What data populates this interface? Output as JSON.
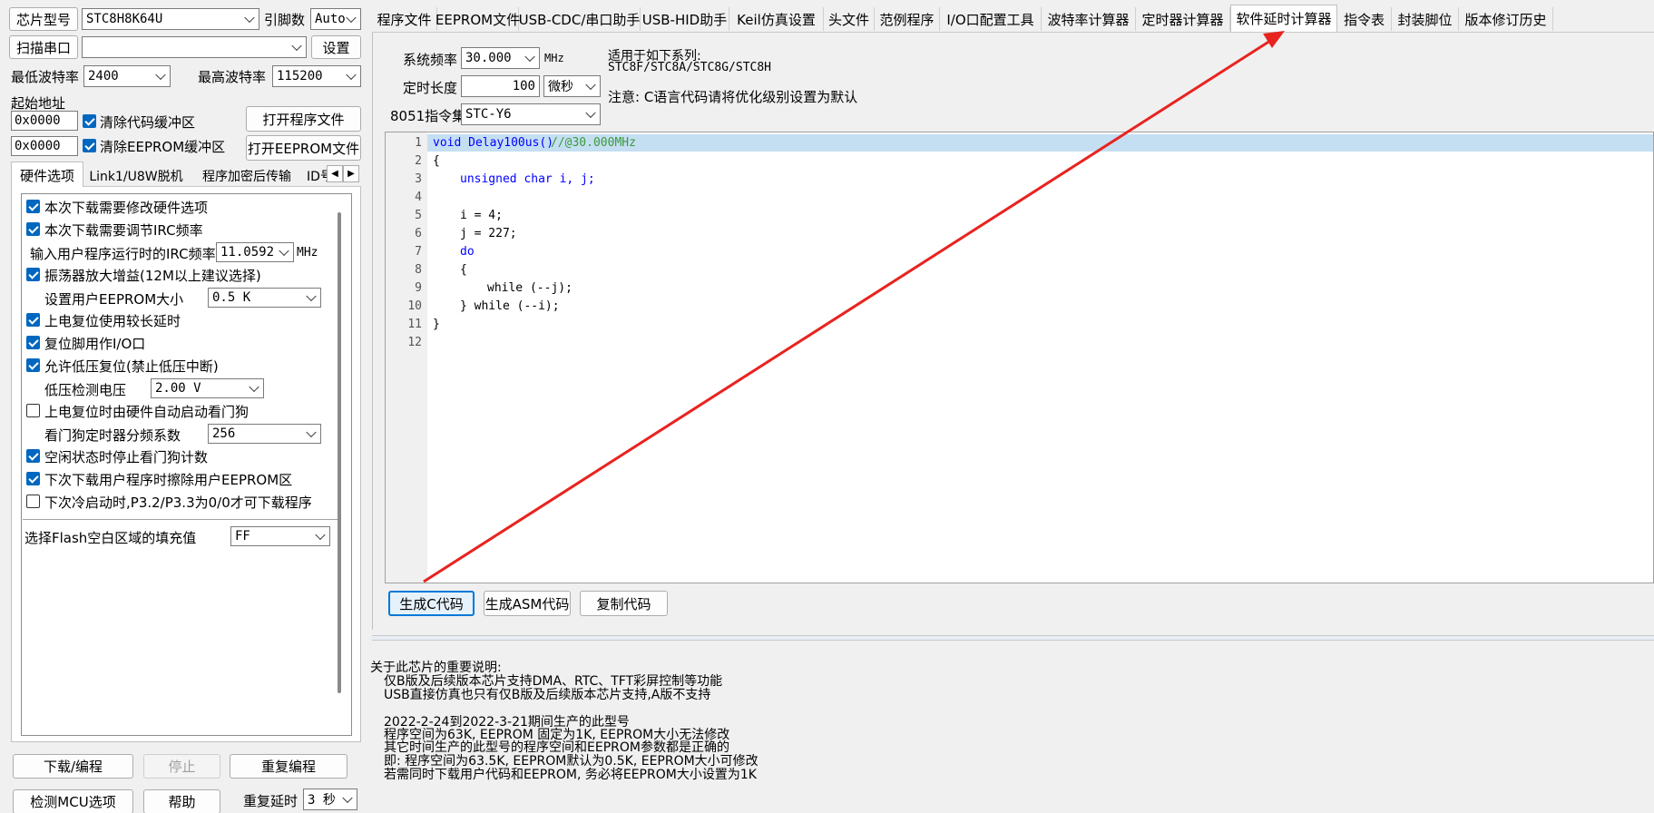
{
  "chip": {
    "label": "芯片型号",
    "value": "STC8H8K64U",
    "pins_label": "引脚数",
    "pins_value": "Auto"
  },
  "port": {
    "scan_label": "扫描串口",
    "value": "",
    "settings_label": "设置"
  },
  "baud": {
    "min_label": "最低波特率",
    "min_value": "2400",
    "max_label": "最高波特率",
    "max_value": "115200"
  },
  "start_addr": {
    "label": "起始地址",
    "code_addr": "0x0000",
    "eeprom_addr": "0x0000",
    "clear_code": "清除代码缓冲区",
    "clear_eeprom": "清除EEPROM缓冲区",
    "open_prog": "打开程序文件",
    "open_eeprom": "打开EEPROM文件"
  },
  "left_tabs": [
    "硬件选项",
    "Link1/U8W脱机",
    "程序加密后传输",
    "ID号"
  ],
  "hw": {
    "opt1": "本次下载需要修改硬件选项",
    "opt2": "本次下载需要调节IRC频率",
    "irc_label": "输入用户程序运行时的IRC频率",
    "irc_value": "11.0592",
    "irc_unit": "MHz",
    "opt3": "振荡器放大增益(12M以上建议选择)",
    "eeprom_size_label": "设置用户EEPROM大小",
    "eeprom_size_value": "0.5 K",
    "opt4": "上电复位使用较长延时",
    "opt5": "复位脚用作I/O口",
    "opt6": "允许低压复位(禁止低压中断)",
    "lvd_label": "低压检测电压",
    "lvd_value": "2.00 V",
    "opt7": "上电复位时由硬件自动启动看门狗",
    "wdt_label": "看门狗定时器分频系数",
    "wdt_value": "256",
    "opt8": "空闲状态时停止看门狗计数",
    "opt9": "下次下载用户程序时擦除用户EEPROM区",
    "opt10": "下次冷启动时,P3.2/P3.3为0/0才可下载程序",
    "fill_label": "选择Flash空白区域的填充值",
    "fill_value": "FF"
  },
  "bottom_btns": {
    "download": "下载/编程",
    "stop": "停止",
    "reprogram": "重复编程",
    "check_mcu": "检测MCU选项",
    "help": "帮助",
    "repeat_delay_label": "重复延时",
    "repeat_delay_value": "3 秒"
  },
  "main_tabs": [
    "程序文件",
    "EEPROM文件",
    "USB-CDC/串口助手",
    "USB-HID助手",
    "Keil仿真设置",
    "头文件",
    "范例程序",
    "I/O口配置工具",
    "波特率计算器",
    "定时器计算器",
    "软件延时计算器",
    "指令表",
    "封装脚位",
    "版本修订历史"
  ],
  "delay": {
    "freq_label": "系统频率",
    "freq_value": "30.000",
    "freq_unit": "MHz",
    "len_label": "定时长度",
    "len_value": "100",
    "len_unit": "微秒",
    "isa_label": "8051指令集",
    "isa_value": "STC-Y6",
    "applies_label": "适用于如下系列:",
    "applies_series": "STC8F/STC8A/STC8G/STC8H",
    "note": "注意: C语言代码请将优化级别设置为默认",
    "gen_c": "生成C代码",
    "gen_asm": "生成ASM代码",
    "copy": "复制代码"
  },
  "code": {
    "line_numbers": [
      "1",
      "2",
      "3",
      "4",
      "5",
      "6",
      "7",
      "8",
      "9",
      "10",
      "11",
      "12"
    ],
    "l1_fn": "void Delay100us()",
    "l1_comment": "//@30.000MHz",
    "l2": "{",
    "l3": "unsigned char i, j;",
    "l5": "i = 4;",
    "l6": "j = 227;",
    "l7": "do",
    "l8": "{",
    "l9": "while (--j);",
    "l10": "} while (--i);",
    "l11": "}"
  },
  "info": {
    "title": "关于此芯片的重要说明:",
    "l1": "仅B版及后续版本芯片支持DMA、RTC、TFT彩屏控制等功能",
    "l2": "USB直接仿真也只有仅B版及后续版本芯片支持,A版不支持",
    "l3": "2022-2-24到2022-3-21期间生产的此型号",
    "l4": "程序空间为63K, EEPROM 固定为1K, EEPROM大小无法修改",
    "l5": "其它时间生产的此型号的程序空间和EEPROM参数都是正确的",
    "l6": "即: 程序空间为63.5K, EEPROM默认为0.5K, EEPROM大小可修改",
    "l7": "若需同时下载用户代码和EEPROM, 务必将EEPROM大小设置为1K"
  },
  "colors": {
    "accent": "#0067c0",
    "annotation_arrow": "#e8231f",
    "highlight_line": "#c5dff2"
  }
}
